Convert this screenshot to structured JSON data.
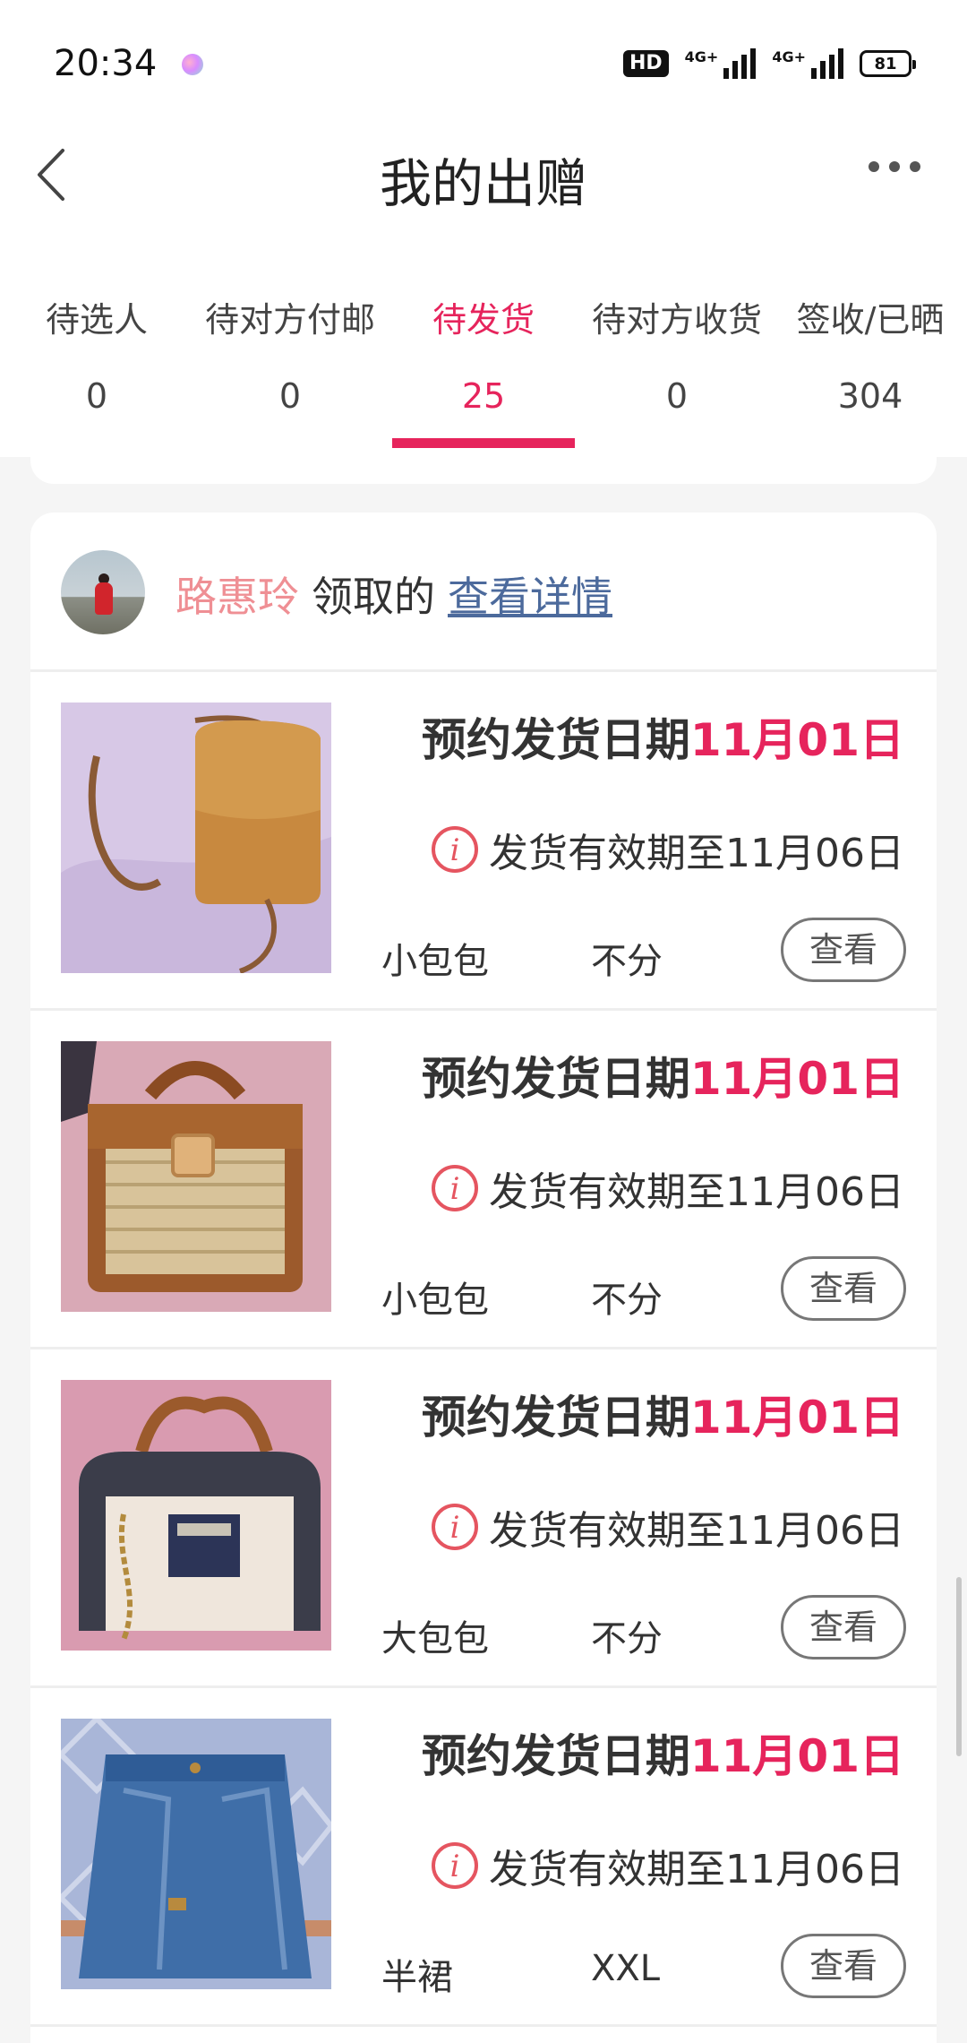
{
  "status_bar": {
    "time": "20:34",
    "hd_label": "HD",
    "network_1": "4G+",
    "network_2": "4G+",
    "battery": "81"
  },
  "header": {
    "title": "我的出赠"
  },
  "tabs": [
    {
      "label": "待选人",
      "count": "0",
      "active": false
    },
    {
      "label": "待对方付邮",
      "count": "0",
      "active": false
    },
    {
      "label": "待发货",
      "count": "25",
      "active": true
    },
    {
      "label": "待对方收货",
      "count": "0",
      "active": false
    },
    {
      "label": "签收/已晒",
      "count": "304",
      "active": false
    }
  ],
  "colors": {
    "accent": "#e6245c",
    "claimer_name": "#ef8f94",
    "link": "#4c6a9c",
    "info_icon": "#e55560"
  },
  "order": {
    "claimer": "路惠玲",
    "claim_verb": "领取的",
    "detail_link": "查看详情",
    "items": [
      {
        "delivery_label": "预约发货日期",
        "delivery_date": "11月01日",
        "validity": "发货有效期至11月06日",
        "category": "小包包",
        "size": "不分",
        "view_label": "查看"
      },
      {
        "delivery_label": "预约发货日期",
        "delivery_date": "11月01日",
        "validity": "发货有效期至11月06日",
        "category": "小包包",
        "size": "不分",
        "view_label": "查看"
      },
      {
        "delivery_label": "预约发货日期",
        "delivery_date": "11月01日",
        "validity": "发货有效期至11月06日",
        "category": "大包包",
        "size": "不分",
        "view_label": "查看"
      },
      {
        "delivery_label": "预约发货日期",
        "delivery_date": "11月01日",
        "validity": "发货有效期至11月06日",
        "category": "半裙",
        "size": "XXL",
        "view_label": "查看"
      }
    ]
  }
}
